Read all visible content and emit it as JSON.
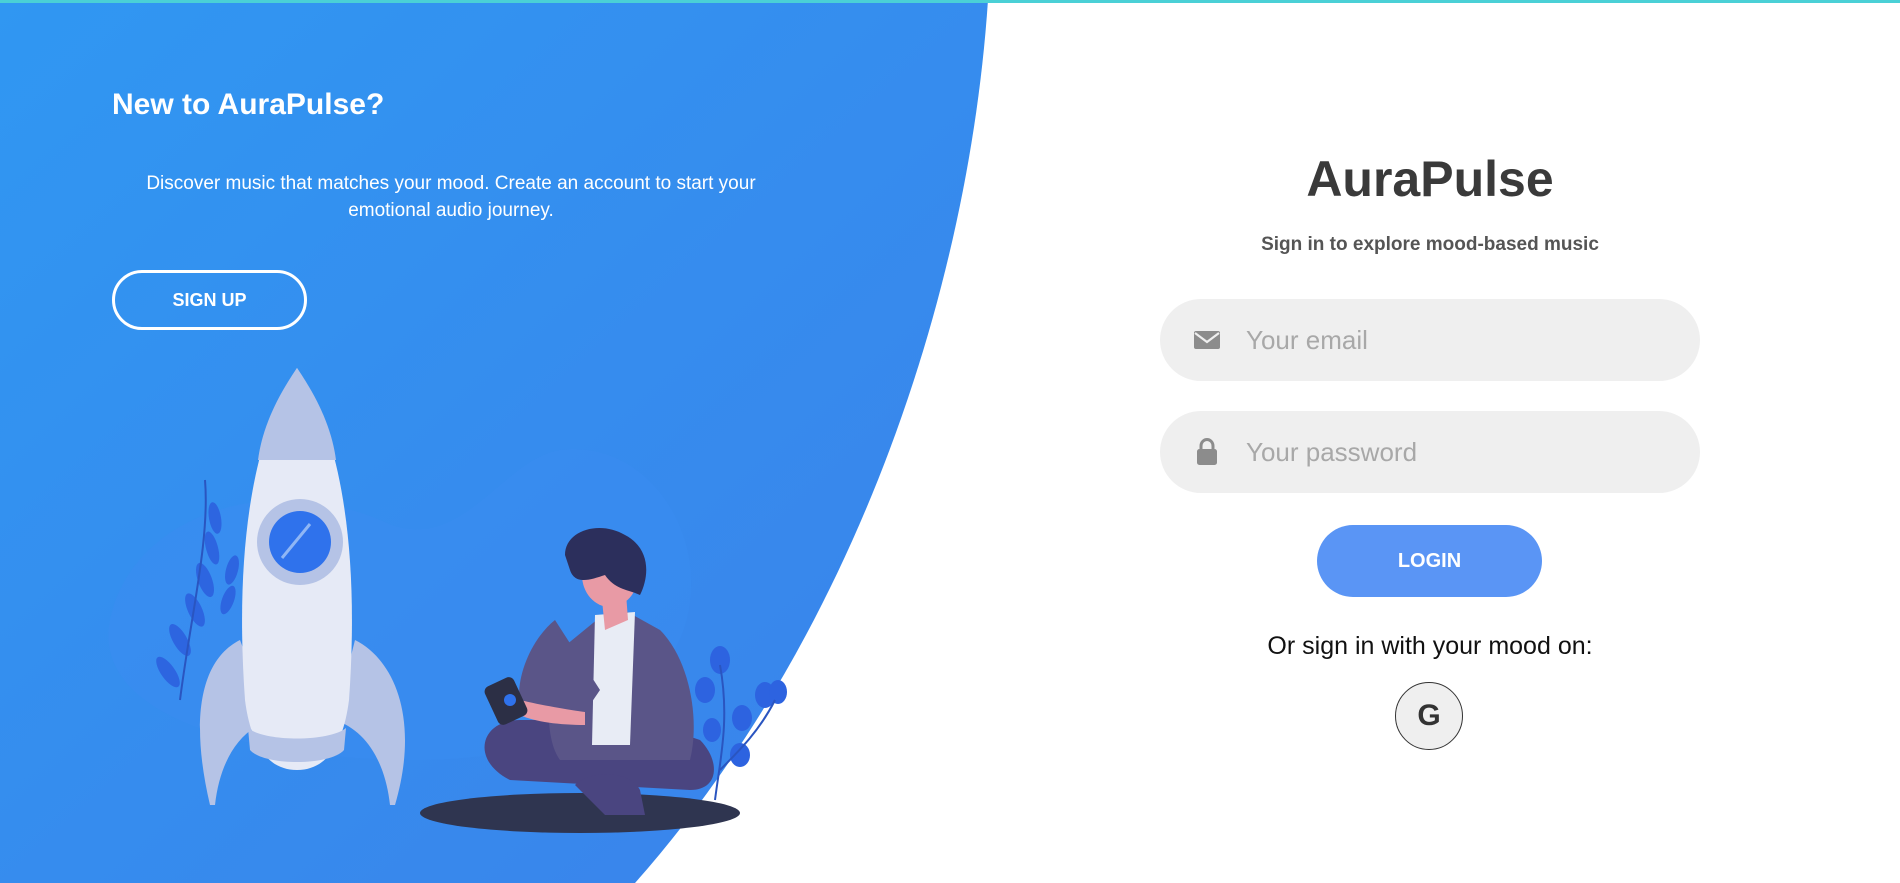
{
  "colors": {
    "accent_blue": "#3393f0",
    "login_blue": "#5a95f5",
    "top_strip": "#4ad0d6",
    "field_bg": "#efefef"
  },
  "left_panel": {
    "title": "New to AuraPulse?",
    "description": "Discover music that matches your mood. Create an account to start your emotional audio journey.",
    "signup_label": "SIGN UP"
  },
  "right_panel": {
    "brand": "AuraPulse",
    "subtitle": "Sign in to explore mood-based music",
    "email": {
      "placeholder": "Your email",
      "value": "",
      "icon": "envelope-icon"
    },
    "password": {
      "placeholder": "Your password",
      "value": "",
      "icon": "lock-icon"
    },
    "login_label": "LOGIN",
    "social_text": "Or sign in with your mood on:",
    "google_label": "G"
  }
}
